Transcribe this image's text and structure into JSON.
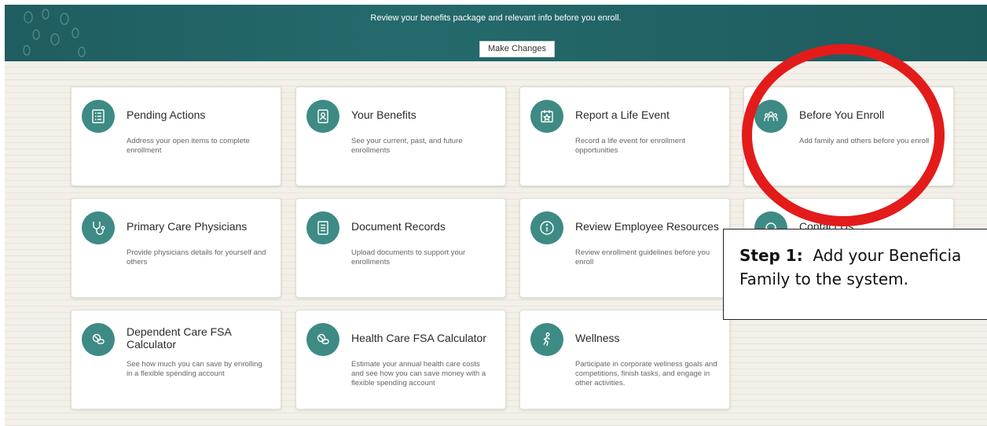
{
  "banner": {
    "text": "Review your benefits package and relevant info before you enroll.",
    "button_label": "Make Changes"
  },
  "colors": {
    "banner": "#1f5d60",
    "icon_circle": "#3e8a84",
    "highlight_ring": "#e31b1b",
    "background": "#f3efe9"
  },
  "cards": [
    {
      "icon": "checklist-icon",
      "title": "Pending Actions",
      "desc": "Address your open items to complete enrollment"
    },
    {
      "icon": "id-badge-icon",
      "title": "Your Benefits",
      "desc": "See your current, past, and future enrollments"
    },
    {
      "icon": "calendar-star-icon",
      "title": "Report a Life Event",
      "desc": "Record a life event for enrollment opportunities"
    },
    {
      "icon": "people-group-icon",
      "title": "Before You Enroll",
      "desc": "Add family and others before you enroll"
    },
    {
      "icon": "stethoscope-icon",
      "title": "Primary Care Physicians",
      "desc": "Provide physicians details for yourself and others"
    },
    {
      "icon": "document-icon",
      "title": "Document Records",
      "desc": "Upload documents to support your enrollments"
    },
    {
      "icon": "info-icon",
      "title": "Review Employee Resources",
      "desc": "Review enrollment guidelines before you enroll"
    },
    {
      "icon": "contact-icon",
      "title": "Contact Us",
      "desc": ""
    },
    {
      "icon": "pills-icon",
      "title": "Dependent Care FSA Calculator",
      "desc": "See how much you can save by enrolling in a flexible spending account"
    },
    {
      "icon": "pills-icon",
      "title": "Health Care FSA Calculator",
      "desc": "Estimate your annual health care costs and see how you can save money with a flexible spending account"
    },
    {
      "icon": "running-person-icon",
      "title": "Wellness",
      "desc": "Participate in corporate wellness goals and competitions, finish tasks, and engage in other activities."
    }
  ],
  "callout": {
    "step_label": "Step 1",
    "line1_text": "  Add your Beneficia",
    "line2_text": "Family to the system."
  }
}
